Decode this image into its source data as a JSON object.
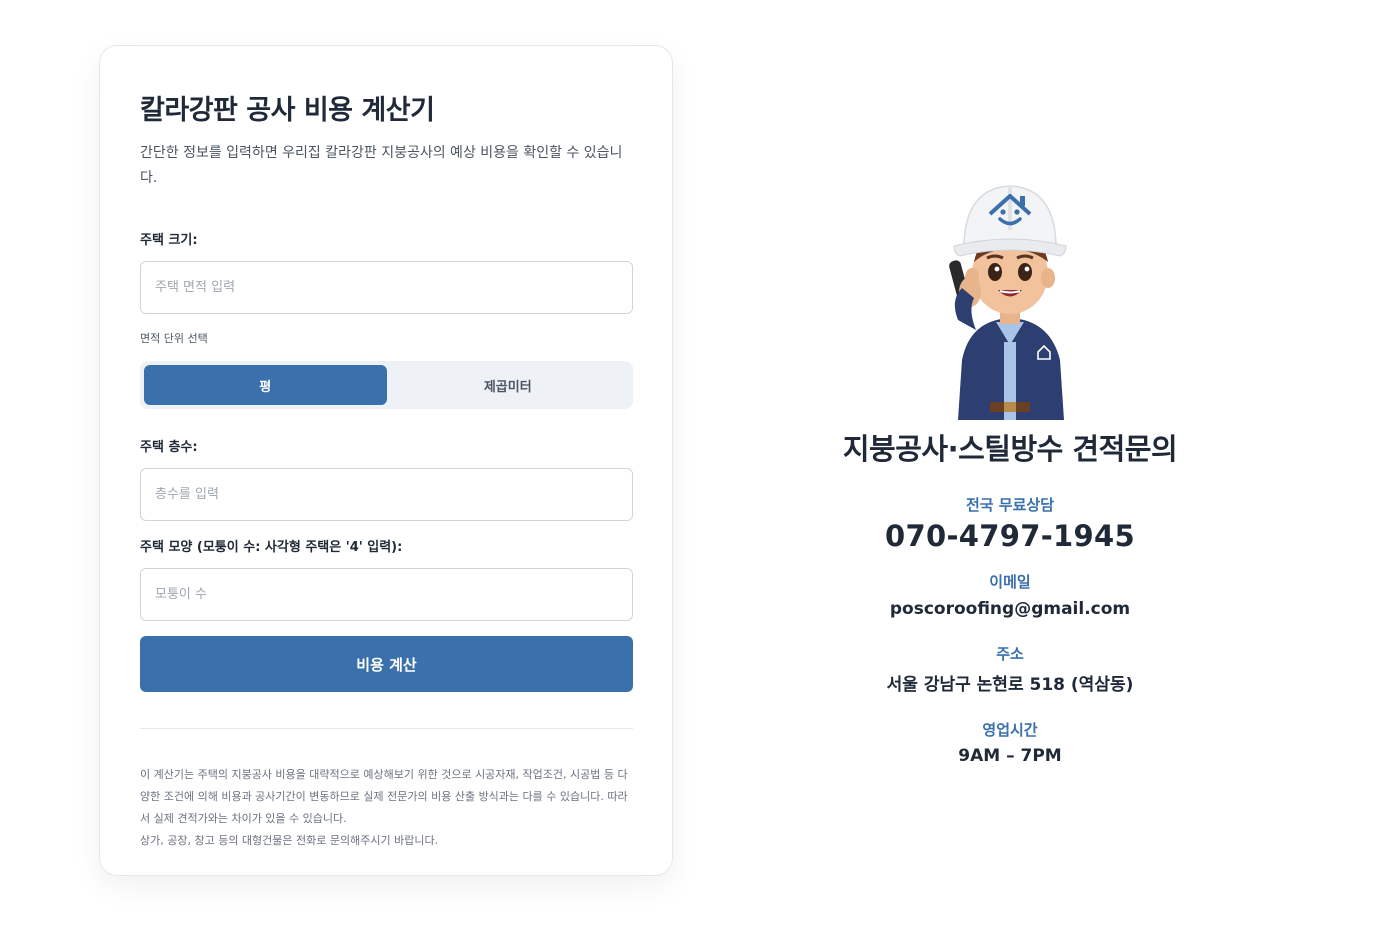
{
  "calculator": {
    "title": "칼라강판 공사 비용 계산기",
    "subtitle": "간단한 정보를 입력하면 우리집 칼라강판 지붕공사의 예상 비용을 확인할 수 있습니다.",
    "house_size": {
      "label": "주택 크기:",
      "value": "",
      "placeholder": "주택 면적 입력"
    },
    "unit": {
      "label": "면적 단위 선택",
      "options": [
        "평",
        "제곱미터"
      ],
      "selected": "평"
    },
    "floors": {
      "label": "주택 층수:",
      "value": "",
      "placeholder": "층수를 입력"
    },
    "corners": {
      "label": "주택 모양 (모퉁이 수: 사각형 주택은 '4' 입력):",
      "value": "",
      "placeholder": "모퉁이 수"
    },
    "calculate_label": "비용 계산",
    "disclaimer_1": "이 계산기는 주택의 지붕공사 비용을 대략적으로 예상해보기 위한 것으로 시공자재, 작업조건, 시공법 등 다양한 조건에 의해 비용과 공사기간이 변동하므로 실제 전문가의 비용 산출 방식과는 다를 수 있습니다. 따라서 실제 견적가와는 차이가 있을 수 있습니다.",
    "disclaimer_2": "상가, 공장, 창고 등의 대형건물은 전화로 문의해주시기 바랍니다."
  },
  "contact": {
    "title": "지붕공사·스틸방수 견적문의",
    "phone_label": "전국 무료상담",
    "phone": "070-4797-1945",
    "email_label": "이메일",
    "email": "poscoroofing@gmail.com",
    "address_label": "주소",
    "address": "서울 강남구 논현로 518 (역삼동)",
    "hours_label": "영업시간",
    "hours": "9AM – 7PM",
    "mascot_icon": "worker-mascot-icon"
  },
  "colors": {
    "accent": "#3a70ab",
    "text": "#1f2937",
    "segment_bg": "#eef1f5"
  }
}
